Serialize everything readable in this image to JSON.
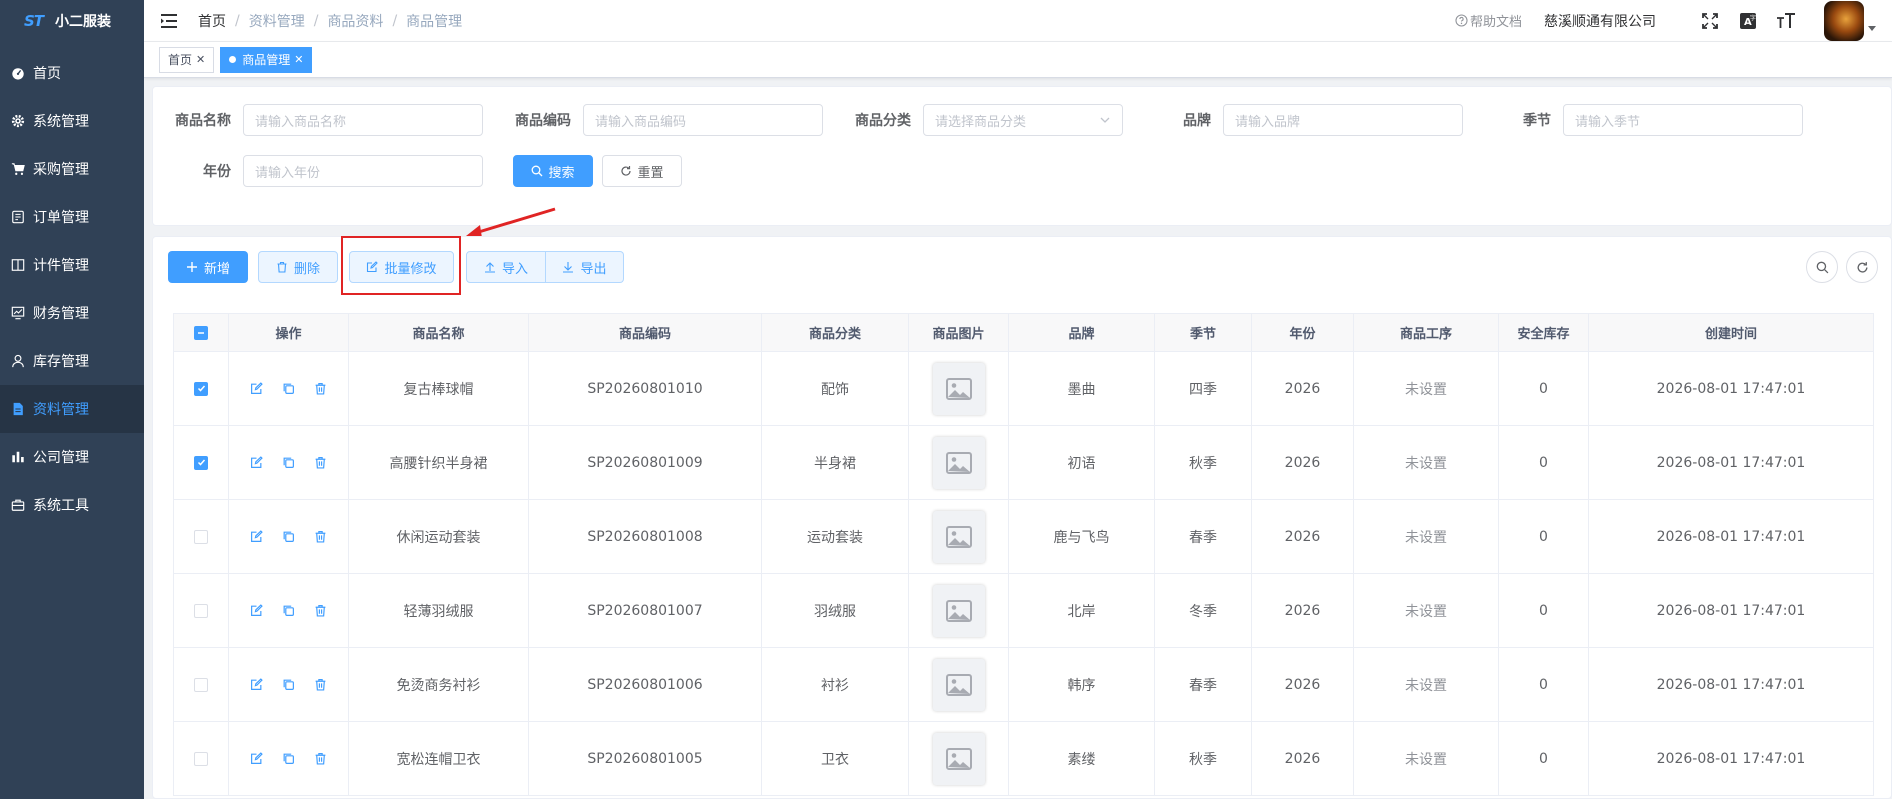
{
  "app": {
    "logo_mark": "ST",
    "name": "小二服装"
  },
  "sidebar": {
    "items": [
      {
        "label": "首页",
        "icon": "dashboard-icon"
      },
      {
        "label": "系统管理",
        "icon": "gear-icon"
      },
      {
        "label": "采购管理",
        "icon": "cart-icon"
      },
      {
        "label": "订单管理",
        "icon": "order-icon"
      },
      {
        "label": "计件管理",
        "icon": "book-icon"
      },
      {
        "label": "财务管理",
        "icon": "chart-icon"
      },
      {
        "label": "库存管理",
        "icon": "user-icon"
      },
      {
        "label": "资料管理",
        "icon": "document-icon",
        "active": true
      },
      {
        "label": "公司管理",
        "icon": "bar-chart-icon"
      },
      {
        "label": "系统工具",
        "icon": "toolbox-icon"
      }
    ]
  },
  "navbar": {
    "breadcrumb": [
      "首页",
      "资料管理",
      "商品资料",
      "商品管理"
    ],
    "help": "帮助文档",
    "company": "慈溪顺通有限公司"
  },
  "tags": [
    {
      "label": "首页",
      "active": false
    },
    {
      "label": "商品管理",
      "active": true
    }
  ],
  "search": {
    "fields": [
      {
        "label": "商品名称",
        "placeholder": "请输入商品名称"
      },
      {
        "label": "商品编码",
        "placeholder": "请输入商品编码"
      },
      {
        "label": "商品分类",
        "placeholder": "请选择商品分类"
      },
      {
        "label": "品牌",
        "placeholder": "请输入品牌"
      },
      {
        "label": "季节",
        "placeholder": "请输入季节"
      },
      {
        "label": "年份",
        "placeholder": "请输入年份"
      }
    ],
    "search_btn": "搜索",
    "reset_btn": "重置"
  },
  "toolbar": {
    "add": "新增",
    "delete": "删除",
    "batch_edit": "批量修改",
    "import": "导入",
    "export": "导出"
  },
  "table": {
    "headers": [
      "操作",
      "商品名称",
      "商品编码",
      "商品分类",
      "商品图片",
      "品牌",
      "季节",
      "年份",
      "商品工序",
      "安全库存",
      "创建时间"
    ],
    "rows": [
      {
        "checked": true,
        "name": "复古棒球帽",
        "code": "SP20260801010",
        "category": "配饰",
        "brand": "墨曲",
        "season": "四季",
        "year": "2026",
        "process": "未设置",
        "stock": "0",
        "created": "2026-08-01 17:47:01"
      },
      {
        "checked": true,
        "name": "高腰针织半身裙",
        "code": "SP20260801009",
        "category": "半身裙",
        "brand": "初语",
        "season": "秋季",
        "year": "2026",
        "process": "未设置",
        "stock": "0",
        "created": "2026-08-01 17:47:01"
      },
      {
        "checked": false,
        "name": "休闲运动套装",
        "code": "SP20260801008",
        "category": "运动套装",
        "brand": "鹿与飞鸟",
        "season": "春季",
        "year": "2026",
        "process": "未设置",
        "stock": "0",
        "created": "2026-08-01 17:47:01"
      },
      {
        "checked": false,
        "name": "轻薄羽绒服",
        "code": "SP20260801007",
        "category": "羽绒服",
        "brand": "北岸",
        "season": "冬季",
        "year": "2026",
        "process": "未设置",
        "stock": "0",
        "created": "2026-08-01 17:47:01"
      },
      {
        "checked": false,
        "name": "免烫商务衬衫",
        "code": "SP20260801006",
        "category": "衬衫",
        "brand": "韩序",
        "season": "春季",
        "year": "2026",
        "process": "未设置",
        "stock": "0",
        "created": "2026-08-01 17:47:01"
      },
      {
        "checked": false,
        "name": "宽松连帽卫衣",
        "code": "SP20260801005",
        "category": "卫衣",
        "brand": "素缕",
        "season": "秋季",
        "year": "2026",
        "process": "未设置",
        "stock": "0",
        "created": "2026-08-01 17:47:01"
      }
    ]
  },
  "colors": {
    "primary": "#409eff",
    "sidebar_bg": "#304156",
    "annotation": "#e02424"
  }
}
